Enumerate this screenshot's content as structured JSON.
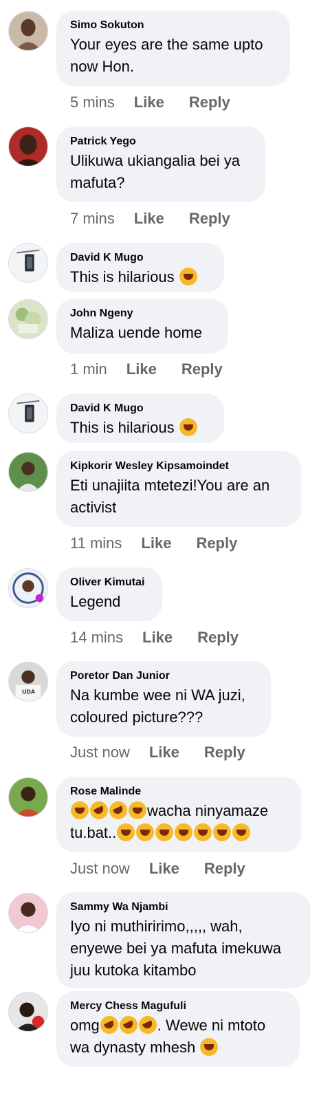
{
  "comments": [
    {
      "name": "Simo Sokuton",
      "text": "Your eyes are the same upto now Hon.",
      "time": "5 mins",
      "like": "Like",
      "reply": "Reply"
    },
    {
      "name": "Patrick Yego",
      "text": "Ulikuwa ukiangalia bei ya mafuta?",
      "time": "7 mins",
      "like": "Like",
      "reply": "Reply"
    },
    {
      "name": "David K Mugo",
      "text": "This is hilarious"
    },
    {
      "name": "John Ngeny",
      "text": "Maliza uende home",
      "time": "1 min",
      "like": "Like",
      "reply": "Reply"
    },
    {
      "name": "David K Mugo",
      "text": "This is hilarious"
    },
    {
      "name": "Kipkorir Wesley Kipsamoindet",
      "text": "Eti unajiita mtetezi!You are an activist",
      "time": "11 mins",
      "like": "Like",
      "reply": "Reply"
    },
    {
      "name": "Oliver Kimutai",
      "text": "Legend",
      "time": "14 mins",
      "like": "Like",
      "reply": "Reply"
    },
    {
      "name": "Poretor Dan Junior",
      "text": "Na kumbe wee ni WA juzi, coloured picture???",
      "time": "Just now",
      "like": "Like",
      "reply": "Reply"
    },
    {
      "name": "Rose Malinde",
      "text_a": "wacha ninyamaze",
      "text_b": "tu.bat..",
      "time": "Just now",
      "like": "Like",
      "reply": "Reply"
    },
    {
      "name": "Sammy Wa Njambi",
      "text": "Iyo ni muthiririmo,,,,, wah, enyewe bei ya mafuta imekuwa juu kutoka kitambo"
    },
    {
      "name": "Mercy Chess Magufuli",
      "text_a": "omg",
      "text_b": ". Wewe ni mtoto",
      "text_c": "wa dynasty mhesh"
    }
  ],
  "avatar_badge_text": "UDA"
}
